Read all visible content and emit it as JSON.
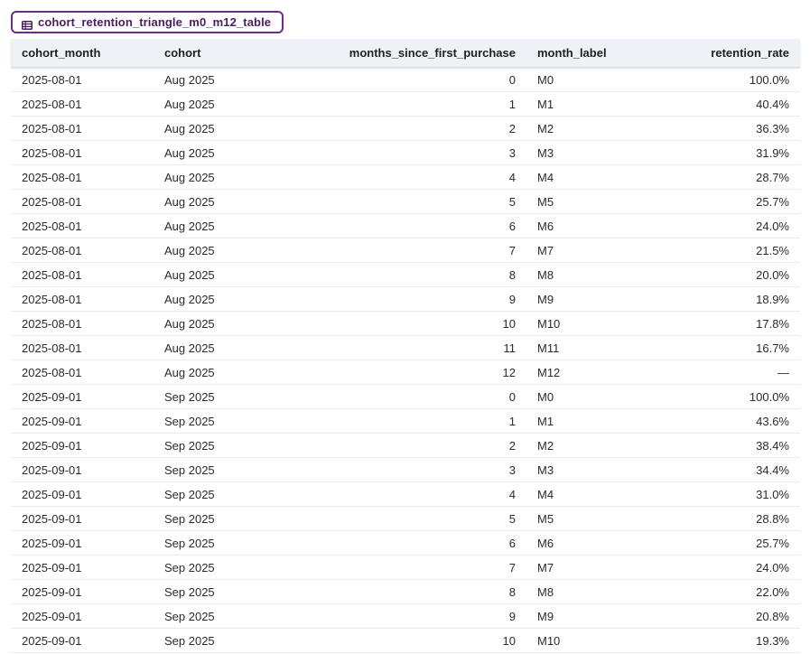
{
  "table_name": "cohort_retention_triangle_m0_m12_table",
  "columns": [
    "cohort_month",
    "cohort",
    "months_since_first_purchase",
    "month_label",
    "retention_rate"
  ],
  "rows": [
    [
      "2025-08-01",
      "Aug 2025",
      "0",
      "M0",
      "100.0%"
    ],
    [
      "2025-08-01",
      "Aug 2025",
      "1",
      "M1",
      "40.4%"
    ],
    [
      "2025-08-01",
      "Aug 2025",
      "2",
      "M2",
      "36.3%"
    ],
    [
      "2025-08-01",
      "Aug 2025",
      "3",
      "M3",
      "31.9%"
    ],
    [
      "2025-08-01",
      "Aug 2025",
      "4",
      "M4",
      "28.7%"
    ],
    [
      "2025-08-01",
      "Aug 2025",
      "5",
      "M5",
      "25.7%"
    ],
    [
      "2025-08-01",
      "Aug 2025",
      "6",
      "M6",
      "24.0%"
    ],
    [
      "2025-08-01",
      "Aug 2025",
      "7",
      "M7",
      "21.5%"
    ],
    [
      "2025-08-01",
      "Aug 2025",
      "8",
      "M8",
      "20.0%"
    ],
    [
      "2025-08-01",
      "Aug 2025",
      "9",
      "M9",
      "18.9%"
    ],
    [
      "2025-08-01",
      "Aug 2025",
      "10",
      "M10",
      "17.8%"
    ],
    [
      "2025-08-01",
      "Aug 2025",
      "11",
      "M11",
      "16.7%"
    ],
    [
      "2025-08-01",
      "Aug 2025",
      "12",
      "M12",
      "—"
    ],
    [
      "2025-09-01",
      "Sep 2025",
      "0",
      "M0",
      "100.0%"
    ],
    [
      "2025-09-01",
      "Sep 2025",
      "1",
      "M1",
      "43.6%"
    ],
    [
      "2025-09-01",
      "Sep 2025",
      "2",
      "M2",
      "38.4%"
    ],
    [
      "2025-09-01",
      "Sep 2025",
      "3",
      "M3",
      "34.4%"
    ],
    [
      "2025-09-01",
      "Sep 2025",
      "4",
      "M4",
      "31.0%"
    ],
    [
      "2025-09-01",
      "Sep 2025",
      "5",
      "M5",
      "28.8%"
    ],
    [
      "2025-09-01",
      "Sep 2025",
      "6",
      "M6",
      "25.7%"
    ],
    [
      "2025-09-01",
      "Sep 2025",
      "7",
      "M7",
      "24.0%"
    ],
    [
      "2025-09-01",
      "Sep 2025",
      "8",
      "M8",
      "22.0%"
    ],
    [
      "2025-09-01",
      "Sep 2025",
      "9",
      "M9",
      "20.8%"
    ],
    [
      "2025-09-01",
      "Sep 2025",
      "10",
      "M10",
      "19.3%"
    ]
  ],
  "icon": "table-icon",
  "accent_color": "#6d2b8c"
}
